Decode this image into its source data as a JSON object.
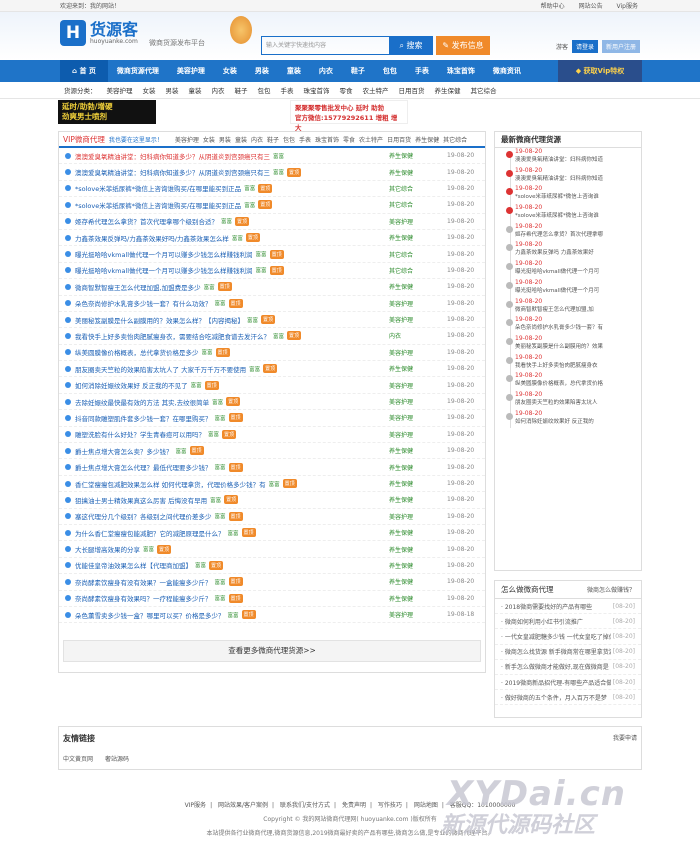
{
  "topbar": {
    "welcome": "欢迎来到：我的网站！",
    "links": [
      "帮助中心",
      "网站公告",
      "Vip服务"
    ]
  },
  "logo": {
    "mark": "H",
    "cn": "货源客",
    "en": "huoyuanke.com",
    "slogan": "微商货源发布平台"
  },
  "search": {
    "placeholder": "输入关键字快速找内容",
    "button": "搜索"
  },
  "publish_button": "发布信息",
  "user": {
    "guest": "游客",
    "login": "请登录",
    "register": "新用户注册"
  },
  "nav": {
    "items": [
      "首 页",
      "微商货源代理",
      "美容护理",
      "女装",
      "男装",
      "童装",
      "内衣",
      "鞋子",
      "包包",
      "手表",
      "珠宝首饰",
      "微商资讯"
    ],
    "vip": "获取Vip特权"
  },
  "cats": {
    "label": "货源分类：",
    "items": [
      "美容护理",
      "女装",
      "男装",
      "童装",
      "内衣",
      "鞋子",
      "包包",
      "手表",
      "珠宝首饰",
      "零食",
      "农土特产",
      "日用百货",
      "养生保健",
      "其它综合"
    ]
  },
  "banner": {
    "b1_line1": "延时/助勃/增硬",
    "b1_line2": "劲爽男士喷剂",
    "b2_line1": "聚聚聚零售批发中心 延时 助勃",
    "b2_line2": "官方微信:15779292611 增粗 增大"
  },
  "list": {
    "title": "VIP微商代理",
    "subtitle": "我也要在这里显示！",
    "filters": [
      "美容护理",
      "女装",
      "男装",
      "童装",
      "内衣",
      "鞋子",
      "包包",
      "手表",
      "珠宝首饰",
      "零食",
      "农土特产",
      "日用百货",
      "养生保健",
      "其它综合"
    ],
    "rz": "富富",
    "ding": "置顶",
    "rows": [
      {
        "title": "澳澳爱臭氧精油讲堂：妇科病你知道多少？从阴道炎到宫颈癌只有三",
        "red": true,
        "ding": false,
        "cat": "养生保健",
        "date": "19-08-20"
      },
      {
        "title": "澳澳爱臭氧精油讲堂：妇科病你知道多少？从阴道炎到宫颈癌只有三",
        "red": false,
        "ding": true,
        "cat": "养生保健",
        "date": "19-08-20"
      },
      {
        "title": "*solove米菲纸尿裤*微信上咨询谁购买/在哪里能买到正品",
        "red": false,
        "ding": true,
        "cat": "其它综合",
        "date": "19-08-20"
      },
      {
        "title": "*solove米菲纸尿裤*微信上咨询谁购买/在哪里能买到正品",
        "red": false,
        "ding": true,
        "cat": "其它综合",
        "date": "19-08-20"
      },
      {
        "title": "姬存希代理怎么拿货？首次代理拿哪个级别合适？",
        "red": false,
        "ding": true,
        "cat": "美容护理",
        "date": "19-08-20"
      },
      {
        "title": "力鑫茶效果反弹吗/力鑫茶效果好吗/力鑫茶效果怎么样",
        "red": false,
        "ding": true,
        "cat": "养生保健",
        "date": "19-08-20"
      },
      {
        "title": "曝光挺哈哈vkmall做代理一个月可以赚多少钱怎么样赚钱利润",
        "red": false,
        "ding": true,
        "cat": "其它综合",
        "date": "19-08-20"
      },
      {
        "title": "曝光挺哈哈vkmall做代理一个月可以赚多少钱怎么样赚钱利润",
        "red": false,
        "ding": true,
        "cat": "其它综合",
        "date": "19-08-20"
      },
      {
        "title": "微商智默智瘦王怎么代理加盟,加盟费是多少",
        "red": false,
        "ding": true,
        "cat": "养生保健",
        "date": "19-08-20"
      },
      {
        "title": "朵色奈尚修护水乳膏多少钱一套？有什么功效？",
        "red": false,
        "ding": true,
        "cat": "美容护理",
        "date": "19-08-20"
      },
      {
        "title": "美丽秘笈副膜是什么副膜用的？效果怎么样？【内容揭秘】",
        "red": false,
        "ding": true,
        "cat": "美容护理",
        "date": "19-08-20"
      },
      {
        "title": "我看快手上好多卖怡肉肥腻瘦身衣，需要结合吃减肥食谱去发汗么？",
        "red": false,
        "ding": true,
        "cat": "内衣",
        "date": "19-08-20"
      },
      {
        "title": "纵美圆膜像价格概表，总代拿货价格是多少",
        "red": false,
        "ding": true,
        "cat": "美容护理",
        "date": "19-08-20"
      },
      {
        "title": "朋友圈卖天竺粒的效果陷害太坑人了 大家千万千万不要使用",
        "red": false,
        "ding": true,
        "cat": "养生保健",
        "date": "19-08-20"
      },
      {
        "title": "如何消除妊娠纹效果好 反正我的不见了",
        "red": false,
        "ding": true,
        "cat": "美容护理",
        "date": "19-08-20"
      },
      {
        "title": "去除妊娠纹最快最有效的方法 其实,去纹很简单",
        "red": false,
        "ding": true,
        "cat": "美容护理",
        "date": "19-08-20"
      },
      {
        "title": "抖音同款雕塑肌件套多少钱一套？在哪里购买？",
        "red": false,
        "ding": true,
        "cat": "美容护理",
        "date": "19-08-20"
      },
      {
        "title": "雕塑洗脸有什么好处？学生青春痘可以用吗？",
        "red": false,
        "ding": true,
        "cat": "美容护理",
        "date": "19-08-20"
      },
      {
        "title": "爵士焦点增大膏怎么卖？多少钱？",
        "red": false,
        "ding": true,
        "cat": "养生保健",
        "date": "19-08-20"
      },
      {
        "title": "爵士焦点增大膏怎么代理？最低代理要多少钱？",
        "red": false,
        "ding": true,
        "cat": "养生保健",
        "date": "19-08-20"
      },
      {
        "title": "香仁堂瘦瘦包减肥效果怎么样 如何代理拿货，代理价格多少钱？有",
        "red": false,
        "ding": true,
        "cat": "养生保健",
        "date": "19-08-20"
      },
      {
        "title": "狙擒油士男士精效果真这么厉害 后悔没有早用",
        "red": false,
        "ding": true,
        "cat": "养生保健",
        "date": "19-08-20"
      },
      {
        "title": "塞这代理分几个级别？各级别之间代理价差多少",
        "red": false,
        "ding": true,
        "cat": "美容护理",
        "date": "19-08-20"
      },
      {
        "title": "为什么香仁堂瘦瘦包能减肥？它的减肥原理是什么？",
        "red": false,
        "ding": true,
        "cat": "养生保健",
        "date": "19-08-20"
      },
      {
        "title": "大长腿增高效果的分享",
        "red": false,
        "ding": true,
        "cat": "养生保健",
        "date": "19-08-20"
      },
      {
        "title": "优能佳皇帝油效果怎么样【代理商加盟】",
        "red": false,
        "ding": true,
        "cat": "养生保健",
        "date": "19-08-20"
      },
      {
        "title": "奈尚酵素饮瘦身有没有效果？一盒能瘦多少斤？",
        "red": false,
        "ding": true,
        "cat": "养生保健",
        "date": "19-08-20"
      },
      {
        "title": "奈尚酵素饮瘦身有效果吗？一疗程能瘦多少斤？",
        "red": false,
        "ding": true,
        "cat": "养生保健",
        "date": "19-08-20"
      },
      {
        "title": "朵色薰雪卖多少钱一盒？哪里可以买？价格是多少？",
        "red": false,
        "ding": true,
        "cat": "美容护理",
        "date": "19-08-18"
      }
    ],
    "more": "查看更多微商代理货源>>"
  },
  "side1": {
    "title": "最新微商代理货源",
    "items": [
      {
        "date": "19-08-20",
        "text": "澳澳爱臭氧精油讲堂：妇科病你知道"
      },
      {
        "date": "19-08-20",
        "text": "澳澳爱臭氧精油讲堂：妇科病你知道"
      },
      {
        "date": "19-08-20",
        "text": "*solove米菲纸尿裤*微信上咨询谁"
      },
      {
        "date": "19-08-20",
        "text": "*solove米菲纸尿裤*微信上咨询谁"
      },
      {
        "date": "19-08-20",
        "text": "姬存希代理怎么拿货？首次代理拿哪"
      },
      {
        "date": "19-08-20",
        "text": "力鑫茶效果反弹吗 力鑫茶效果好"
      },
      {
        "date": "19-08-20",
        "text": "曝光挺哈哈vkmall做代理一个月可"
      },
      {
        "date": "19-08-20",
        "text": "曝光挺哈哈vkmall做代理一个月可"
      },
      {
        "date": "19-08-20",
        "text": "微商智默智瘦王怎么代理加盟,加"
      },
      {
        "date": "19-08-20",
        "text": "朵色奈尚修护水乳膏多少钱一套？有"
      },
      {
        "date": "19-08-20",
        "text": "美丽秘笈副膜是什么副膜用的？效果"
      },
      {
        "date": "19-08-20",
        "text": "我看快手上好多卖怡肉肥腻瘦身衣"
      },
      {
        "date": "19-08-20",
        "text": "纵美圆膜像价格概表，总代拿货价格"
      },
      {
        "date": "19-08-20",
        "text": "朋友圈卖天竺粒的效果陷害太坑人"
      },
      {
        "date": "19-08-20",
        "text": "如何消除妊娠纹效果好 反正我的"
      }
    ]
  },
  "side2": {
    "title": "怎么做微商代理",
    "more": "微商怎么做赚钱？",
    "items": [
      {
        "text": "2018微商需要找好的产品有哪些",
        "date": "[08-20]"
      },
      {
        "text": "微商如何利用小红书引流推广",
        "date": "[08-20]"
      },
      {
        "text": "一代女皇减肥糖多少钱 一代女皇吃了掉体",
        "date": "[08-20]"
      },
      {
        "text": "微商怎么找货源 新手微商常在哪里拿货源",
        "date": "[08-20]"
      },
      {
        "text": "新手怎么做微商才能做好,现在做微商是",
        "date": "[08-20]"
      },
      {
        "text": "2019微商新品招代理-有哪些产品适合做",
        "date": "[08-20]"
      },
      {
        "text": "做好微商的五个条件，月入百万不是梦",
        "date": "[08-20]"
      }
    ]
  },
  "friend_links": {
    "title": "友情链接",
    "apply": "我要申请",
    "items": [
      "中文黄页网",
      "奢站源码"
    ]
  },
  "footer": {
    "links": [
      "VIP服务",
      "网站效果/客户案例",
      "联系我们/支付方式",
      "免责声明",
      "写作技巧",
      "网站地图",
      "客服QQ：1010000000"
    ],
    "copyright": "Copyright © 我的网站微商代理网( huoyuanke.com )版权所有",
    "disclaimer": "本站提供各行业微商代理,微商货源信息,2019微商最好卖的产品有哪些,微商怎么做,是专业的微商代理平台。"
  },
  "watermark": {
    "line1": "XYDai.cn",
    "line2": "新源代源码社区"
  }
}
